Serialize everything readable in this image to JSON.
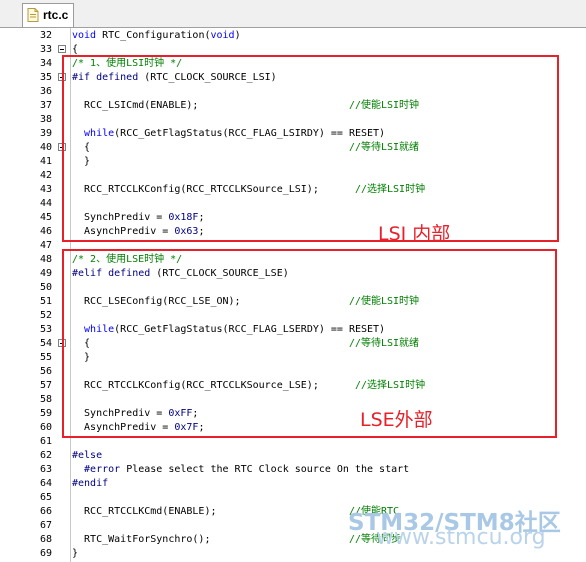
{
  "tab": {
    "label": "rtc.c",
    "icon": "c-file-icon"
  },
  "lines": [
    {
      "n": "32",
      "fold": false,
      "segs": [
        [
          "kw",
          "void "
        ],
        [
          "fn",
          "RTC_Configuration("
        ],
        [
          "kw",
          "void"
        ],
        [
          "fn",
          ")"
        ]
      ]
    },
    {
      "n": "33",
      "fold": true,
      "segs": [
        [
          "fn",
          "{"
        ]
      ]
    },
    {
      "n": "34",
      "fold": false,
      "segs": [
        [
          "cm",
          "/* 1、使用LSI时钟 */"
        ]
      ]
    },
    {
      "n": "35",
      "fold": true,
      "segs": [
        [
          "pp",
          "#if defined "
        ],
        [
          "fn",
          "(RTC_CLOCK_SOURCE_LSI)"
        ]
      ]
    },
    {
      "n": "36",
      "fold": false,
      "segs": []
    },
    {
      "n": "37",
      "fold": false,
      "segs": [
        [
          "fn",
          "  RCC_LSICmd(ENABLE);                         "
        ],
        [
          "cm",
          "//使能LSI时钟"
        ]
      ]
    },
    {
      "n": "38",
      "fold": false,
      "segs": []
    },
    {
      "n": "39",
      "fold": false,
      "segs": [
        [
          "kw",
          "  while"
        ],
        [
          "fn",
          "(RCC_GetFlagStatus(RCC_FLAG_LSIRDY) == RESET)"
        ]
      ]
    },
    {
      "n": "40",
      "fold": true,
      "segs": [
        [
          "fn",
          "  {                                           "
        ],
        [
          "cm",
          "//等待LSI就绪"
        ]
      ]
    },
    {
      "n": "41",
      "fold": false,
      "segs": [
        [
          "fn",
          "  }"
        ]
      ]
    },
    {
      "n": "42",
      "fold": false,
      "segs": []
    },
    {
      "n": "43",
      "fold": false,
      "segs": [
        [
          "fn",
          "  RCC_RTCCLKConfig(RCC_RTCCLKSource_LSI);      "
        ],
        [
          "cm",
          "//选择LSI时钟"
        ]
      ]
    },
    {
      "n": "44",
      "fold": false,
      "segs": []
    },
    {
      "n": "45",
      "fold": false,
      "segs": [
        [
          "fn",
          "  SynchPrediv = "
        ],
        [
          "num",
          "0x18F"
        ],
        [
          "fn",
          ";"
        ]
      ]
    },
    {
      "n": "46",
      "fold": false,
      "segs": [
        [
          "fn",
          "  AsynchPrediv = "
        ],
        [
          "num",
          "0x63"
        ],
        [
          "fn",
          ";"
        ]
      ]
    },
    {
      "n": "47",
      "fold": false,
      "segs": []
    },
    {
      "n": "48",
      "fold": false,
      "segs": [
        [
          "cm",
          "/* 2、使用LSE时钟 */"
        ]
      ]
    },
    {
      "n": "49",
      "fold": false,
      "segs": [
        [
          "pp",
          "#elif defined "
        ],
        [
          "fn",
          "(RTC_CLOCK_SOURCE_LSE)"
        ]
      ]
    },
    {
      "n": "50",
      "fold": false,
      "segs": []
    },
    {
      "n": "51",
      "fold": false,
      "segs": [
        [
          "fn",
          "  RCC_LSEConfig(RCC_LSE_ON);                  "
        ],
        [
          "cm",
          "//使能LSI时钟"
        ]
      ]
    },
    {
      "n": "52",
      "fold": false,
      "segs": []
    },
    {
      "n": "53",
      "fold": false,
      "segs": [
        [
          "kw",
          "  while"
        ],
        [
          "fn",
          "(RCC_GetFlagStatus(RCC_FLAG_LSERDY) == RESET)"
        ]
      ]
    },
    {
      "n": "54",
      "fold": true,
      "segs": [
        [
          "fn",
          "  {                                           "
        ],
        [
          "cm",
          "//等待LSI就绪"
        ]
      ]
    },
    {
      "n": "55",
      "fold": false,
      "segs": [
        [
          "fn",
          "  }"
        ]
      ]
    },
    {
      "n": "56",
      "fold": false,
      "segs": []
    },
    {
      "n": "57",
      "fold": false,
      "segs": [
        [
          "fn",
          "  RCC_RTCCLKConfig(RCC_RTCCLKSource_LSE);      "
        ],
        [
          "cm",
          "//选择LSI时钟"
        ]
      ]
    },
    {
      "n": "58",
      "fold": false,
      "segs": []
    },
    {
      "n": "59",
      "fold": false,
      "segs": [
        [
          "fn",
          "  SynchPrediv = "
        ],
        [
          "num",
          "0xFF"
        ],
        [
          "fn",
          ";"
        ]
      ]
    },
    {
      "n": "60",
      "fold": false,
      "segs": [
        [
          "fn",
          "  AsynchPrediv = "
        ],
        [
          "num",
          "0x7F"
        ],
        [
          "fn",
          ";"
        ]
      ]
    },
    {
      "n": "61",
      "fold": false,
      "segs": []
    },
    {
      "n": "62",
      "fold": false,
      "segs": [
        [
          "pp",
          "#else"
        ]
      ]
    },
    {
      "n": "63",
      "fold": false,
      "segs": [
        [
          "pp",
          "  #error "
        ],
        [
          "fn",
          "Please select the RTC Clock source On the start"
        ]
      ]
    },
    {
      "n": "64",
      "fold": false,
      "segs": [
        [
          "pp",
          "#endif"
        ]
      ]
    },
    {
      "n": "65",
      "fold": false,
      "segs": []
    },
    {
      "n": "66",
      "fold": false,
      "segs": [
        [
          "fn",
          "  RCC_RTCCLKCmd(ENABLE);                      "
        ],
        [
          "cm",
          "//使能RTC"
        ]
      ]
    },
    {
      "n": "67",
      "fold": false,
      "segs": []
    },
    {
      "n": "68",
      "fold": false,
      "segs": [
        [
          "fn",
          "  RTC_WaitForSynchro();                       "
        ],
        [
          "cm",
          "//等待同步"
        ]
      ]
    },
    {
      "n": "69",
      "fold": false,
      "segs": [
        [
          "fn",
          "}"
        ]
      ]
    }
  ],
  "annotations": {
    "lsi": "LSI 内部",
    "lse": "LSE外部"
  },
  "watermark": {
    "brand": "STM32/STM8社区",
    "url": "www.stmcu.org"
  },
  "colors": {
    "annotation_red": "#e8202a",
    "keyword_blue": "#0000ff",
    "comment_green": "#008000"
  }
}
